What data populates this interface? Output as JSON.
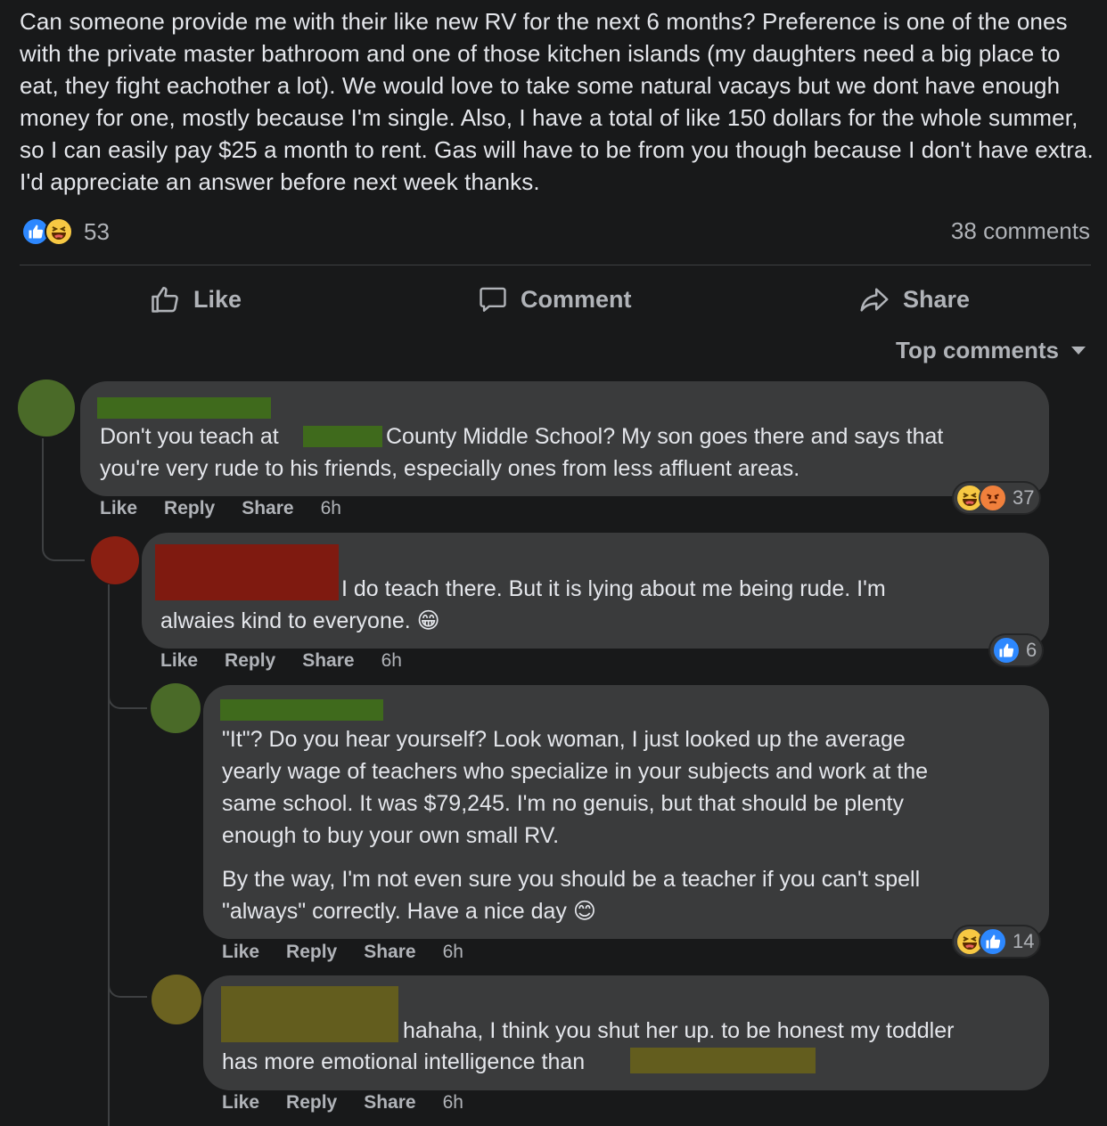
{
  "post": {
    "text": "Can someone provide me with their like new RV for the next 6 months? Preference is one of the ones with the private master bathroom and one of those kitchen islands (my daughters need a big place to eat, they fight eachother a lot). We would love to take some natural vacays but we dont have enough money for one, mostly because I'm single. Also, I have a total of like 150 dollars for the whole summer, so I can easily pay $25 a month to rent. Gas will have to be from you though because I don't have extra. I'd appreciate an answer before next week thanks.",
    "reaction_count": "53",
    "comments_count": "38 comments"
  },
  "actions": {
    "like": "Like",
    "comment": "Comment",
    "share": "Share"
  },
  "sort": {
    "label": "Top comments"
  },
  "meta_labels": {
    "like": "Like",
    "reply": "Reply",
    "share": "Share"
  },
  "comments": [
    {
      "text_a": "Don't you teach at",
      "text_b": "County Middle School? My son goes there and says that",
      "text_c": "you're very rude to his friends, especially ones from less affluent areas.",
      "time": "6h",
      "reactions": "37",
      "avatar_color": "#4a6a28",
      "redact_color": "#3f6a1c"
    },
    {
      "text_a": "I do teach there. But it is lying about me being rude. I'm",
      "text_b": "alwaies kind to everyone. 😁",
      "time": "6h",
      "reactions": "6",
      "avatar_color": "#8a1f12",
      "redact_color": "#7f1a10"
    },
    {
      "para1_l1": "\"It\"? Do you hear yourself? Look woman, I just looked up the average",
      "para1_l2": "yearly wage of teachers who specialize in your subjects and work at the",
      "para1_l3": "same school. It was $79,245. I'm no genuis, but that should be plenty",
      "para1_l4": "enough to buy your own small RV.",
      "para2_l1": "By the way, I'm not even sure you should be a teacher if you can't spell",
      "para2_l2": "\"always\" correctly. Have a nice day 😊",
      "time": "6h",
      "reactions": "14",
      "avatar_color": "#4a6a28",
      "redact_color": "#3f6a1c"
    },
    {
      "text_a": "hahaha, I think you shut her up. to be honest my toddler",
      "text_b": "has more emotional intelligence than",
      "time": "6h",
      "avatar_color": "#6b6220",
      "redact_color": "#635d1e"
    }
  ],
  "colors": {
    "background": "#18191a",
    "bubble": "#3a3b3c",
    "like_blue": "#2d88ff",
    "haha_yellow": "#f7c843",
    "angry_orange": "#f0803c"
  }
}
